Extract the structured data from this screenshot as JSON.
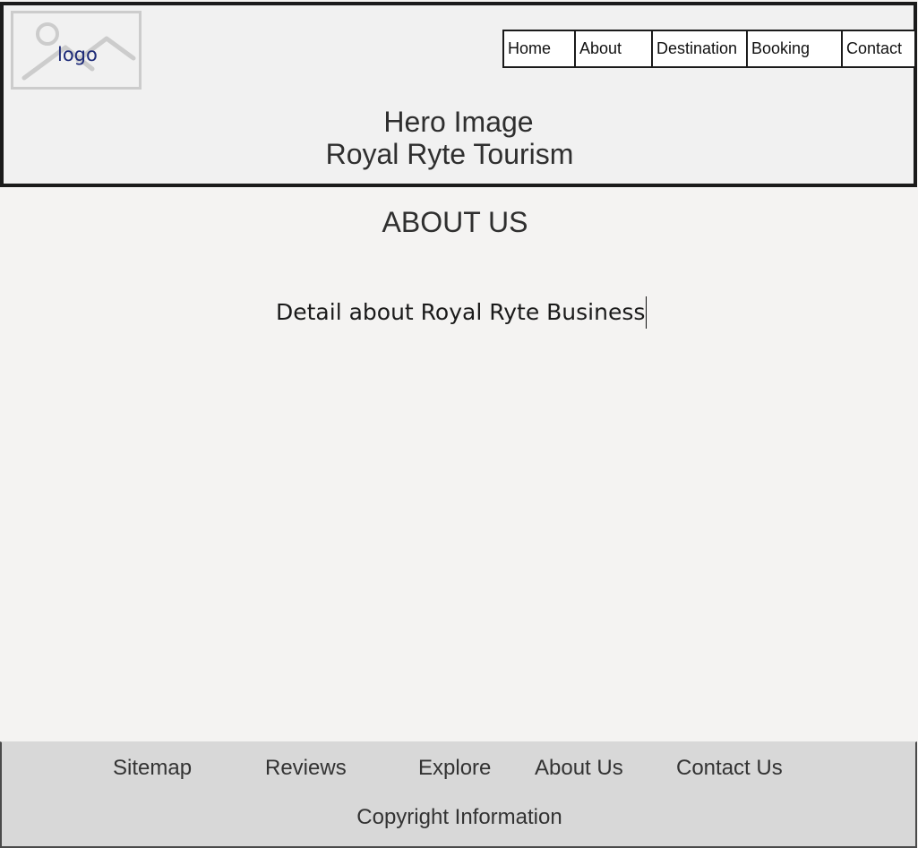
{
  "header": {
    "logo_text": "logo",
    "nav": [
      "Home",
      "About",
      "Destination",
      "Booking",
      "Contact"
    ],
    "hero_line1": "Hero Image",
    "hero_line2": "Royal Ryte Tourism"
  },
  "main": {
    "heading": "ABOUT US",
    "detail": "Detail about Royal Ryte Business"
  },
  "footer": {
    "links": [
      "Sitemap",
      "Reviews",
      "Explore",
      "About Us",
      "Contact Us"
    ],
    "copyright": "Copyright Information"
  },
  "colors": {
    "header_bg": "#f1f1f1",
    "page_bg": "#f4f3f2",
    "footer_bg": "#d8d8d8",
    "logo_text": "#1d2a78",
    "border": "#1b1b1b"
  },
  "icons": {
    "logo": "image-placeholder-icon"
  }
}
